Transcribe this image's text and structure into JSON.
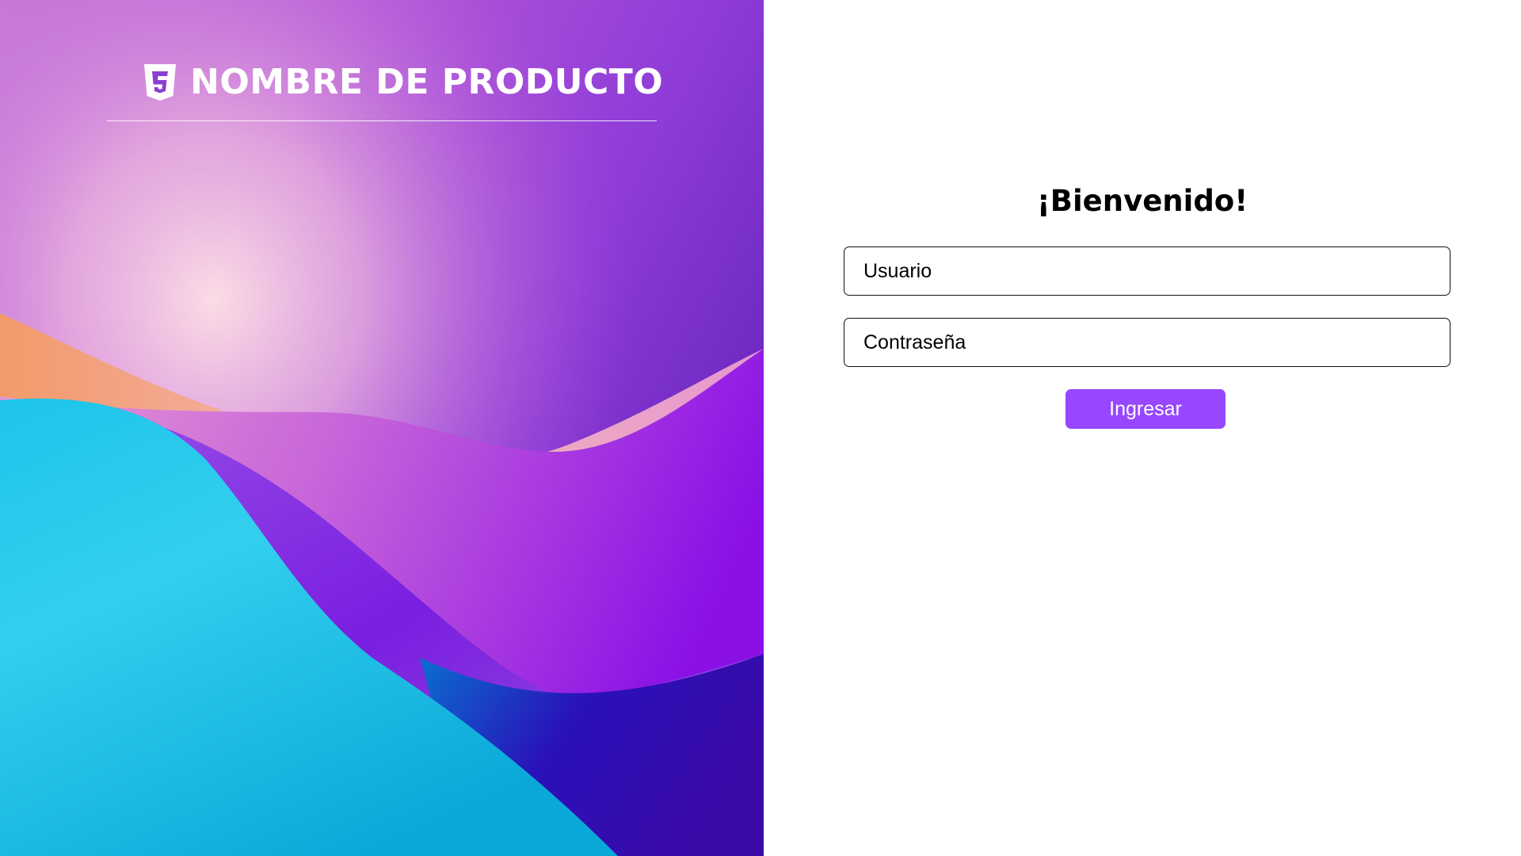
{
  "brand": {
    "name": "NOMBRE DE PRODUCTO",
    "icon": "css3-icon"
  },
  "login": {
    "title": "¡Bienvenido!",
    "username_placeholder": "Usuario",
    "password_placeholder": "Contraseña",
    "submit_label": "Ingresar"
  },
  "colors": {
    "accent": "#9747ff",
    "panel_background": "#ffffff",
    "field_border": "#111111"
  }
}
